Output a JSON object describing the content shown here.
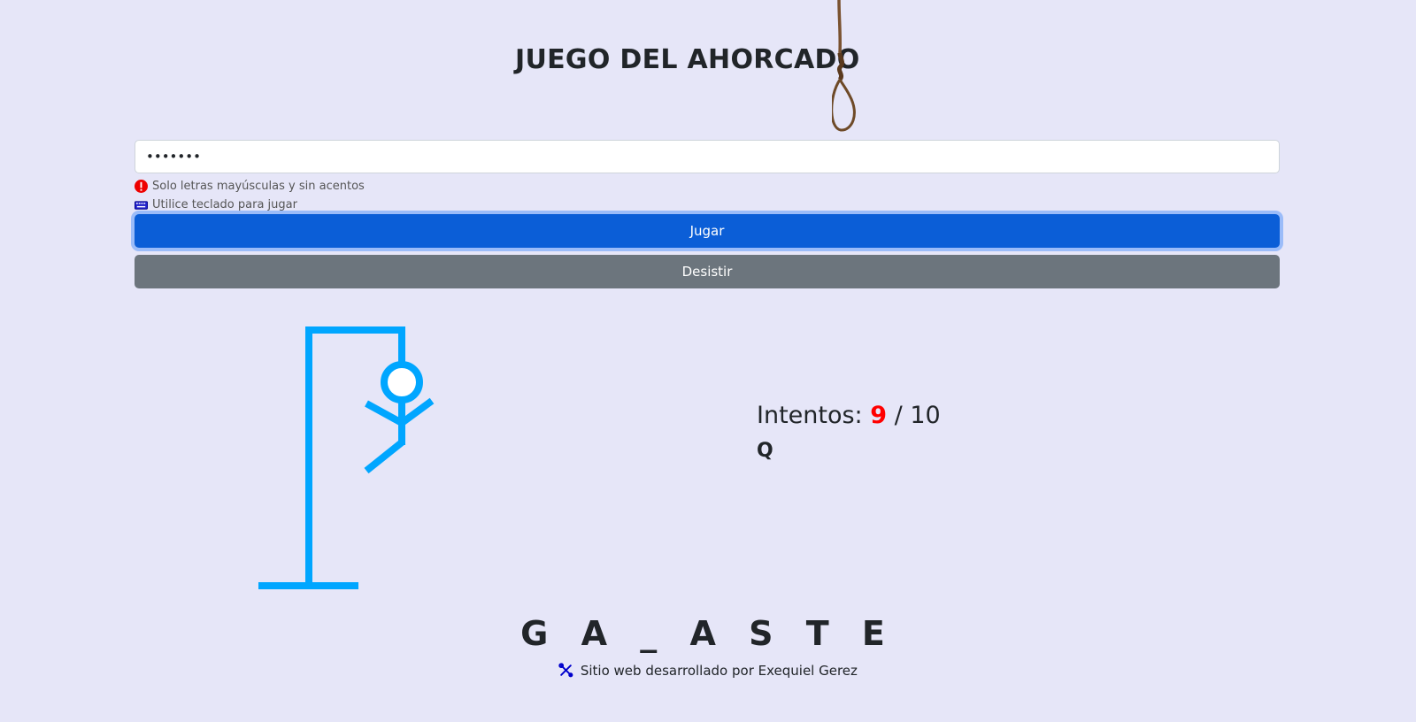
{
  "header": {
    "title": "JUEGO DEL AHORCADO"
  },
  "input": {
    "value": "•••••••"
  },
  "hints": [
    {
      "icon": "error-icon",
      "text": "Solo letras mayúsculas y sin acentos"
    },
    {
      "icon": "keyboard-icon",
      "text": "Utilice teclado para jugar"
    }
  ],
  "buttons": {
    "play_label": "Jugar",
    "quit_label": "Desistir"
  },
  "game": {
    "attempts_label": "Intentos:",
    "attempts_used": "9",
    "attempts_total": "/ 10",
    "attempts_used_value": 9,
    "attempts_max_value": 10,
    "wrong_letters": "Q",
    "word_display": "G A _ A S T E"
  },
  "footer": {
    "icon": "tools-icon",
    "text": "Sitio web desarrollado por Exequiel Gerez"
  },
  "colors": {
    "background": "#e6e6f8",
    "hangman": "#00a6ff",
    "primary_button": "#0b5ed7",
    "secondary_button": "#6c757d",
    "attempts_used": "#ff0000"
  }
}
